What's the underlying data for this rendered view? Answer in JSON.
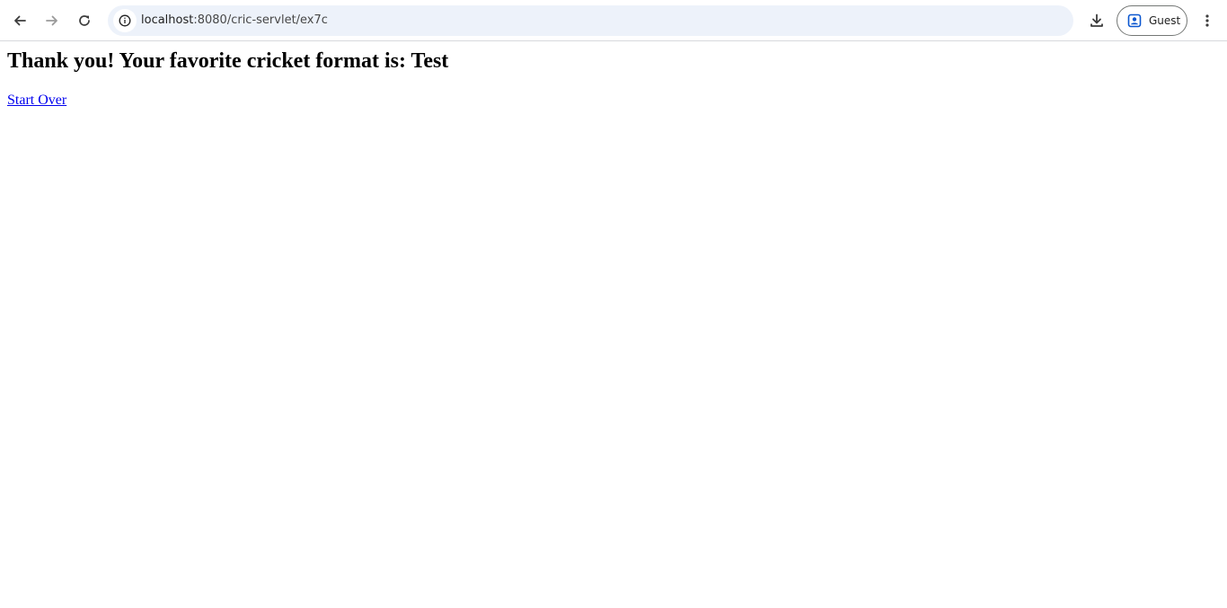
{
  "browser": {
    "url_host": "localhost",
    "url_path": ":8080/cric-servlet/ex7c",
    "profile_label": "Guest",
    "icons": {
      "back": "arrow-left-icon",
      "forward": "arrow-right-icon",
      "reload": "reload-icon",
      "site_info": "info-icon",
      "download": "download-icon",
      "profile": "person-badge-icon",
      "menu": "three-dot-vertical-icon"
    },
    "colors": {
      "omnibox_bg": "#edf2fa",
      "profile_accent": "#0b57d0"
    }
  },
  "page": {
    "heading": "Thank you! Your favorite cricket format is: Test",
    "link_label": "Start Over",
    "link_color": "#0000ee"
  }
}
